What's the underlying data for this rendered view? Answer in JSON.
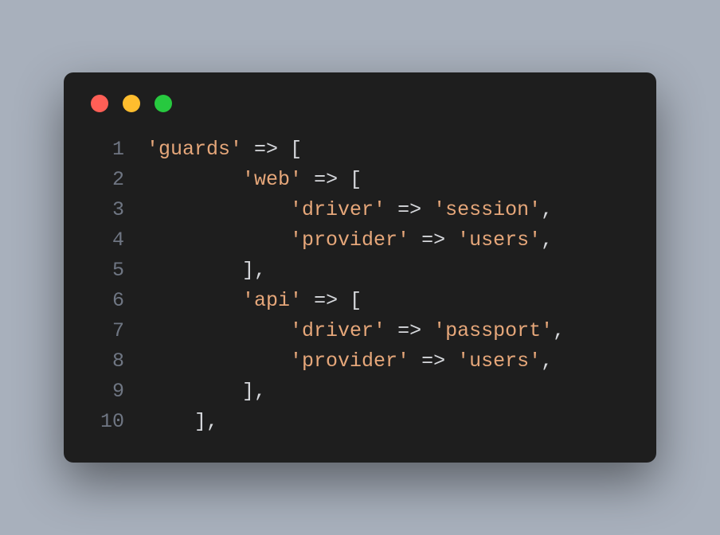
{
  "colors": {
    "page_bg": "#a8b0bc",
    "window_bg": "#1e1e1e",
    "lineno": "#6f7683",
    "string": "#e6a77a",
    "punct": "#d6d8dc",
    "dot_close": "#ff5f56",
    "dot_min": "#ffbd2e",
    "dot_max": "#27c93f"
  },
  "traffic_lights": [
    "close",
    "minimize",
    "maximize"
  ],
  "code": {
    "lines": [
      {
        "n": "1",
        "tokens": [
          {
            "t": "'guards'",
            "c": "str"
          },
          {
            "t": " ",
            "c": "punct"
          },
          {
            "t": "=>",
            "c": "op"
          },
          {
            "t": " [",
            "c": "punct"
          }
        ]
      },
      {
        "n": "2",
        "tokens": [
          {
            "t": "        ",
            "c": "punct"
          },
          {
            "t": "'web'",
            "c": "str"
          },
          {
            "t": " ",
            "c": "punct"
          },
          {
            "t": "=>",
            "c": "op"
          },
          {
            "t": " [",
            "c": "punct"
          }
        ]
      },
      {
        "n": "3",
        "tokens": [
          {
            "t": "            ",
            "c": "punct"
          },
          {
            "t": "'driver'",
            "c": "str"
          },
          {
            "t": " ",
            "c": "punct"
          },
          {
            "t": "=>",
            "c": "op"
          },
          {
            "t": " ",
            "c": "punct"
          },
          {
            "t": "'session'",
            "c": "str"
          },
          {
            "t": ",",
            "c": "punct"
          }
        ]
      },
      {
        "n": "4",
        "tokens": [
          {
            "t": "            ",
            "c": "punct"
          },
          {
            "t": "'provider'",
            "c": "str"
          },
          {
            "t": " ",
            "c": "punct"
          },
          {
            "t": "=>",
            "c": "op"
          },
          {
            "t": " ",
            "c": "punct"
          },
          {
            "t": "'users'",
            "c": "str"
          },
          {
            "t": ",",
            "c": "punct"
          }
        ]
      },
      {
        "n": "5",
        "tokens": [
          {
            "t": "        ],",
            "c": "punct"
          }
        ]
      },
      {
        "n": "6",
        "tokens": [
          {
            "t": "        ",
            "c": "punct"
          },
          {
            "t": "'api'",
            "c": "str"
          },
          {
            "t": " ",
            "c": "punct"
          },
          {
            "t": "=>",
            "c": "op"
          },
          {
            "t": " [",
            "c": "punct"
          }
        ]
      },
      {
        "n": "7",
        "tokens": [
          {
            "t": "            ",
            "c": "punct"
          },
          {
            "t": "'driver'",
            "c": "str"
          },
          {
            "t": " ",
            "c": "punct"
          },
          {
            "t": "=>",
            "c": "op"
          },
          {
            "t": " ",
            "c": "punct"
          },
          {
            "t": "'passport'",
            "c": "str"
          },
          {
            "t": ",",
            "c": "punct"
          }
        ]
      },
      {
        "n": "8",
        "tokens": [
          {
            "t": "            ",
            "c": "punct"
          },
          {
            "t": "'provider'",
            "c": "str"
          },
          {
            "t": " ",
            "c": "punct"
          },
          {
            "t": "=>",
            "c": "op"
          },
          {
            "t": " ",
            "c": "punct"
          },
          {
            "t": "'users'",
            "c": "str"
          },
          {
            "t": ",",
            "c": "punct"
          }
        ]
      },
      {
        "n": "9",
        "tokens": [
          {
            "t": "        ],",
            "c": "punct"
          }
        ]
      },
      {
        "n": "10",
        "tokens": [
          {
            "t": "    ],",
            "c": "punct"
          }
        ]
      }
    ]
  }
}
